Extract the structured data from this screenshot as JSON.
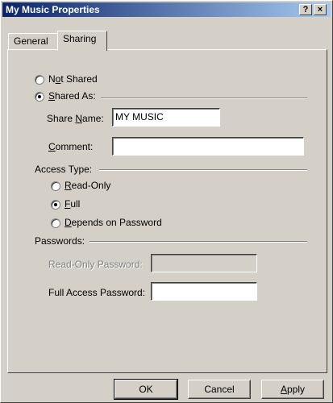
{
  "window": {
    "title": "My Music Properties",
    "help_glyph": "?",
    "close_glyph": "×"
  },
  "tabs": [
    {
      "label": "General",
      "selected": false
    },
    {
      "label": "Sharing",
      "selected": true
    }
  ],
  "sharing": {
    "not_shared": {
      "pre": "N",
      "ul": "o",
      "post": "t Shared",
      "selected": false
    },
    "shared_as": {
      "pre": "",
      "ul": "S",
      "post": "hared As:",
      "selected": true
    },
    "share_name": {
      "pre": "Share ",
      "ul": "N",
      "post": "ame:",
      "value": "MY MUSIC"
    },
    "comment": {
      "pre": "",
      "ul": "C",
      "post": "omment:",
      "value": ""
    },
    "access_type": {
      "label": "Access Type:",
      "read_only": {
        "pre": "",
        "ul": "R",
        "post": "ead-Only",
        "selected": false
      },
      "full": {
        "pre": "",
        "ul": "F",
        "post": "ull",
        "selected": true
      },
      "depends": {
        "pre": "",
        "ul": "D",
        "post": "epends on Password",
        "selected": false
      }
    },
    "passwords": {
      "label": "Passwords:",
      "read_only_password": {
        "label": "Read-Only Password:",
        "value": "",
        "disabled": true
      },
      "full_access_password": {
        "label": "Full Access Password:",
        "value": ""
      }
    }
  },
  "buttons": {
    "ok": "OK",
    "cancel": "Cancel",
    "apply": {
      "pre": "",
      "ul": "A",
      "post": "pply"
    }
  },
  "colors": {
    "title_gradient_start": "#0a246a",
    "title_gradient_end": "#a6caf0",
    "face": "#d4d0c8"
  }
}
